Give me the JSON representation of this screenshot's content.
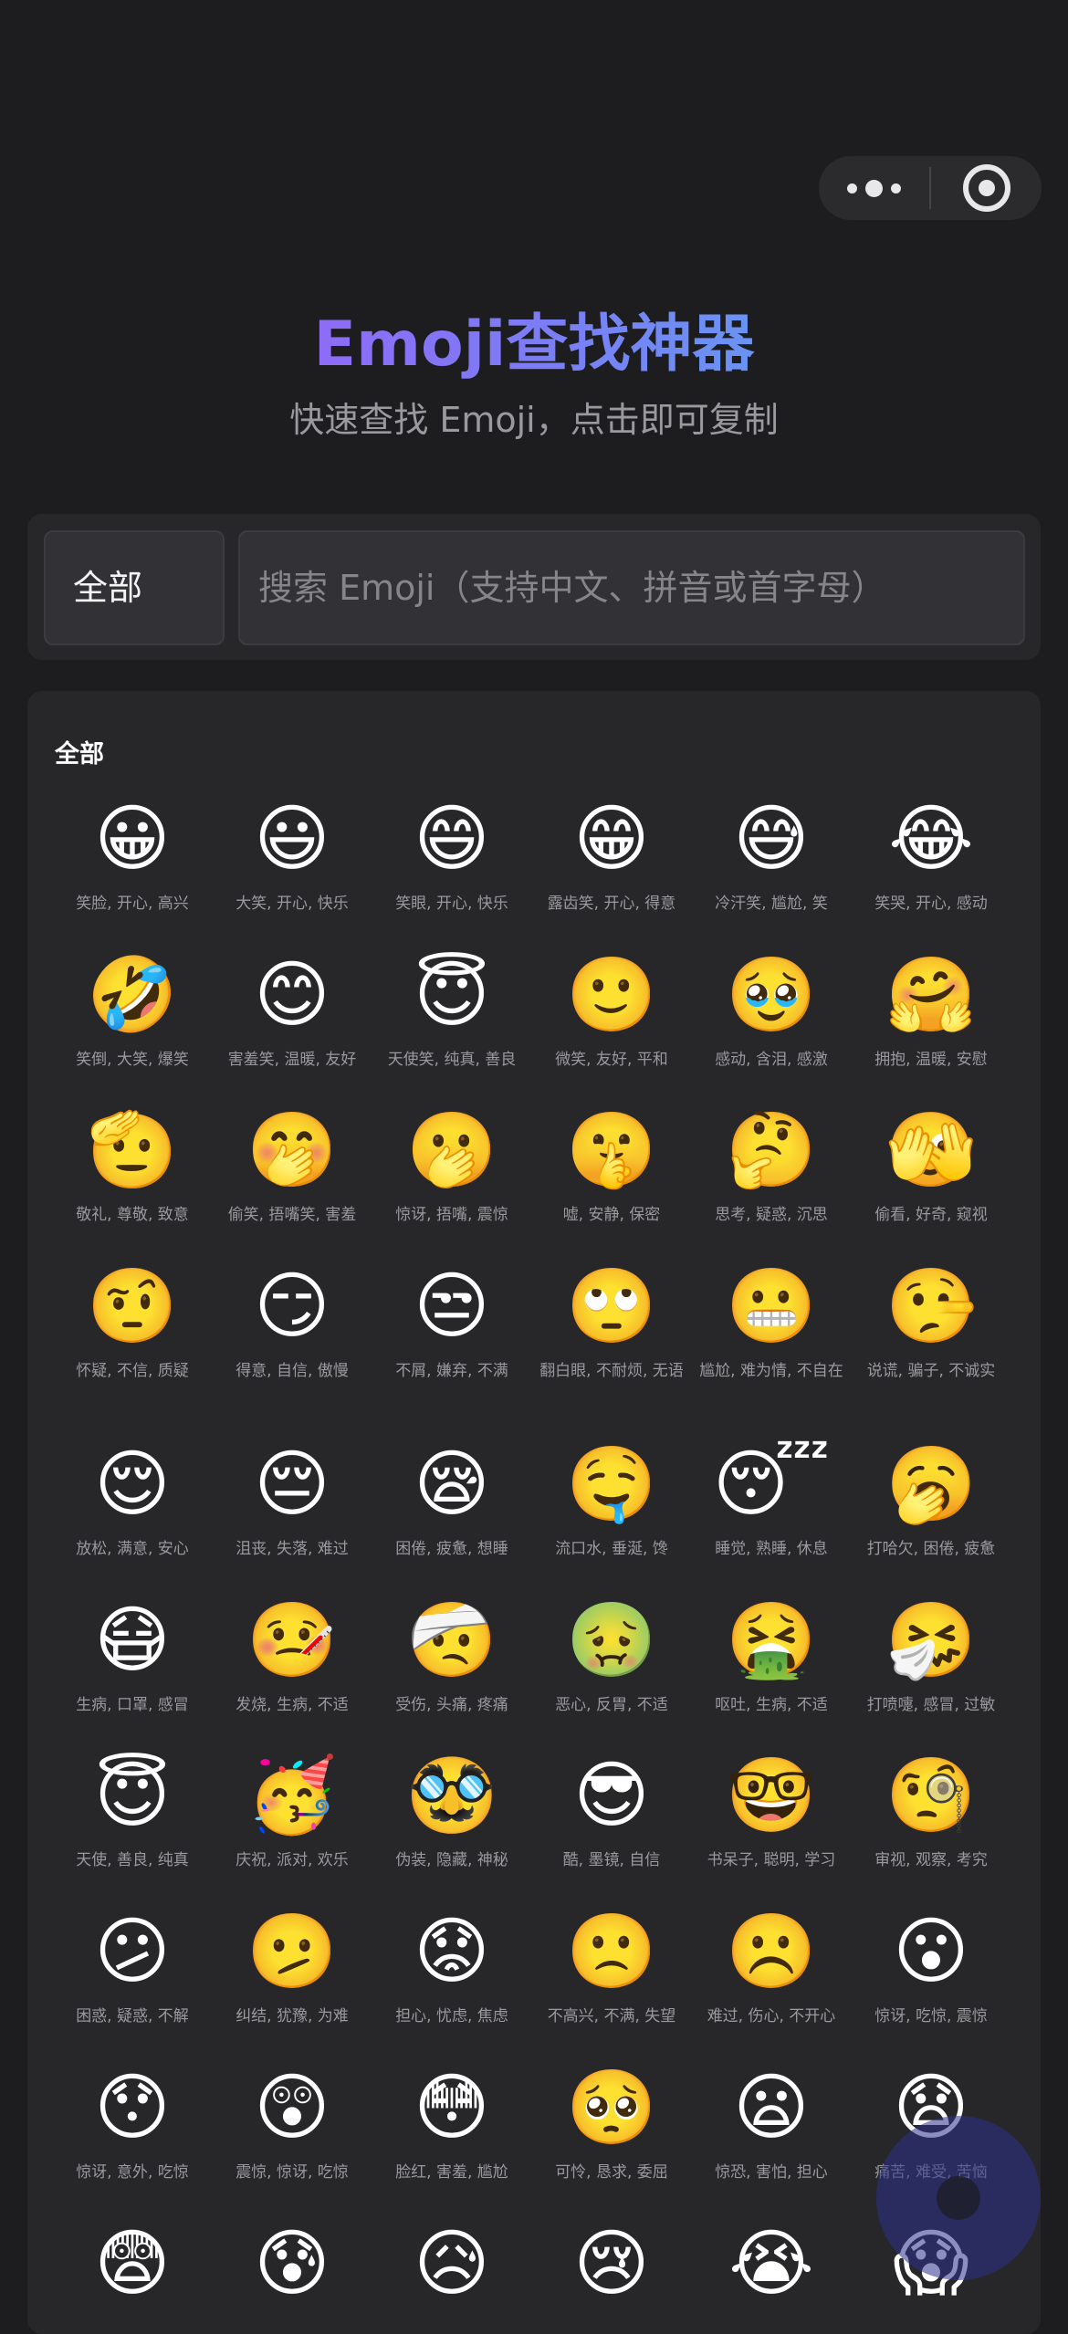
{
  "header": {
    "title": "Emoji查找神器",
    "subtitle": "快速查找 Emoji，点击即可复制"
  },
  "search": {
    "category_selected": "全部",
    "placeholder": "搜索 Emoji（支持中文、拼音或首字母）"
  },
  "list": {
    "category_title": "全部",
    "items": [
      {
        "emoji": "😀",
        "keywords": "笑脸, 开心, 高兴"
      },
      {
        "emoji": "😃",
        "keywords": "大笑, 开心, 快乐"
      },
      {
        "emoji": "😄",
        "keywords": "笑眼, 开心, 快乐"
      },
      {
        "emoji": "😁",
        "keywords": "露齿笑, 开心, 得意"
      },
      {
        "emoji": "😅",
        "keywords": "冷汗笑, 尴尬, 笑"
      },
      {
        "emoji": "😂",
        "keywords": "笑哭, 开心, 感动"
      },
      {
        "emoji": "🤣",
        "keywords": "笑倒, 大笑, 爆笑"
      },
      {
        "emoji": "😊",
        "keywords": "害羞笑, 温暖, 友好"
      },
      {
        "emoji": "😇",
        "keywords": "天使笑, 纯真, 善良"
      },
      {
        "emoji": "🙂",
        "keywords": "微笑, 友好, 平和"
      },
      {
        "emoji": "🥹",
        "keywords": "感动, 含泪, 感激"
      },
      {
        "emoji": "🤗",
        "keywords": "拥抱, 温暖, 安慰"
      },
      {
        "emoji": "🫡",
        "keywords": "敬礼, 尊敬, 致意"
      },
      {
        "emoji": "🤭",
        "keywords": "偷笑, 捂嘴笑, 害羞"
      },
      {
        "emoji": "🫢",
        "keywords": "惊讶, 捂嘴, 震惊"
      },
      {
        "emoji": "🤫",
        "keywords": "嘘, 安静, 保密"
      },
      {
        "emoji": "🤔",
        "keywords": "思考, 疑惑, 沉思"
      },
      {
        "emoji": "🫣",
        "keywords": "偷看, 好奇, 窥视"
      },
      {
        "emoji": "🤨",
        "keywords": "怀疑, 不信, 质疑"
      },
      {
        "emoji": "😏",
        "keywords": "得意, 自信, 傲慢"
      },
      {
        "emoji": "😒",
        "keywords": "不屑, 嫌弃, 不满"
      },
      {
        "emoji": "🙄",
        "keywords": "翻白眼, 不耐烦, 无语"
      },
      {
        "emoji": "😬",
        "keywords": "尴尬, 难为情, 不自在"
      },
      {
        "emoji": "🤥",
        "keywords": "说谎, 骗子, 不诚实"
      },
      {
        "emoji": "😌",
        "keywords": "放松, 满意, 安心"
      },
      {
        "emoji": "😔",
        "keywords": "沮丧, 失落, 难过"
      },
      {
        "emoji": "😪",
        "keywords": "困倦, 疲惫, 想睡"
      },
      {
        "emoji": "🤤",
        "keywords": "流口水, 垂涎, 馋"
      },
      {
        "emoji": "😴",
        "keywords": "睡觉, 熟睡, 休息"
      },
      {
        "emoji": "🥱",
        "keywords": "打哈欠, 困倦, 疲惫"
      },
      {
        "emoji": "😷",
        "keywords": "生病, 口罩, 感冒"
      },
      {
        "emoji": "🤒",
        "keywords": "发烧, 生病, 不适"
      },
      {
        "emoji": "🤕",
        "keywords": "受伤, 头痛, 疼痛"
      },
      {
        "emoji": "🤢",
        "keywords": "恶心, 反胃, 不适"
      },
      {
        "emoji": "🤮",
        "keywords": "呕吐, 生病, 不适"
      },
      {
        "emoji": "🤧",
        "keywords": "打喷嚏, 感冒, 过敏"
      },
      {
        "emoji": "😇",
        "keywords": "天使, 善良, 纯真"
      },
      {
        "emoji": "🥳",
        "keywords": "庆祝, 派对, 欢乐"
      },
      {
        "emoji": "🥸",
        "keywords": "伪装, 隐藏, 神秘"
      },
      {
        "emoji": "😎",
        "keywords": "酷, 墨镜, 自信"
      },
      {
        "emoji": "🤓",
        "keywords": "书呆子, 聪明, 学习"
      },
      {
        "emoji": "🧐",
        "keywords": "审视, 观察, 考究"
      },
      {
        "emoji": "😕",
        "keywords": "困惑, 疑惑, 不解"
      },
      {
        "emoji": "🫤",
        "keywords": "纠结, 犹豫, 为难"
      },
      {
        "emoji": "😟",
        "keywords": "担心, 忧虑, 焦虑"
      },
      {
        "emoji": "🙁",
        "keywords": "不高兴, 不满, 失望"
      },
      {
        "emoji": "☹️",
        "keywords": "难过, 伤心, 不开心"
      },
      {
        "emoji": "😮",
        "keywords": "惊讶, 吃惊, 震惊"
      },
      {
        "emoji": "😯",
        "keywords": "惊讶, 意外, 吃惊"
      },
      {
        "emoji": "😲",
        "keywords": "震惊, 惊讶, 吃惊"
      },
      {
        "emoji": "😳",
        "keywords": "脸红, 害羞, 尴尬"
      },
      {
        "emoji": "🥺",
        "keywords": "可怜, 恳求, 委屈"
      },
      {
        "emoji": "😦",
        "keywords": "惊恐, 害怕, 担心"
      },
      {
        "emoji": "😧",
        "keywords": "痛苦, 难受, 苦恼"
      },
      {
        "emoji": "😨",
        "keywords": ""
      },
      {
        "emoji": "😰",
        "keywords": ""
      },
      {
        "emoji": "😥",
        "keywords": ""
      },
      {
        "emoji": "😢",
        "keywords": ""
      },
      {
        "emoji": "😭",
        "keywords": ""
      },
      {
        "emoji": "😱",
        "keywords": ""
      }
    ]
  },
  "capsule": {
    "more_icon": "more-dots-icon",
    "close_icon": "target-circle-icon"
  },
  "colors": {
    "background": "#1d1d1f",
    "panel": "#27272a",
    "title_gradient": [
      "#a855f7",
      "#4fb5f0"
    ]
  }
}
